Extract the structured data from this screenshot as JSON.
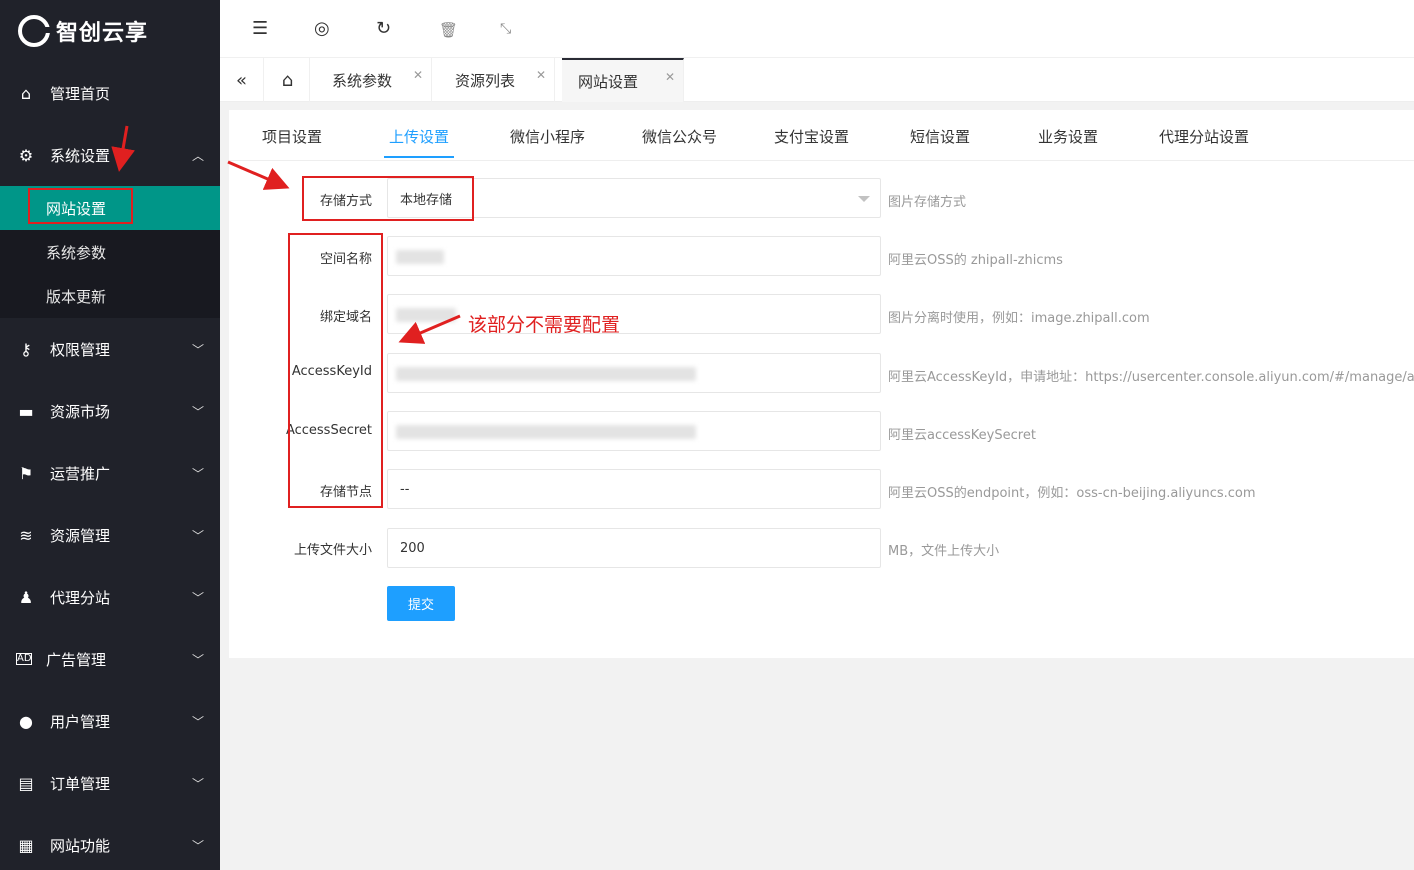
{
  "brand": {
    "name": "智创云享"
  },
  "sidebar": {
    "items": [
      {
        "label": "管理首页",
        "icon": "home-icon"
      },
      {
        "label": "系统设置",
        "icon": "gear-icon",
        "expanded": true
      },
      {
        "label": "权限管理",
        "icon": "user-key-icon"
      },
      {
        "label": "资源市场",
        "icon": "store-icon"
      },
      {
        "label": "运营推广",
        "icon": "flag-icon"
      },
      {
        "label": "资源管理",
        "icon": "layers-icon"
      },
      {
        "label": "代理分站",
        "icon": "users-icon"
      },
      {
        "label": "广告管理",
        "icon": "ad-icon"
      },
      {
        "label": "用户管理",
        "icon": "user-icon"
      },
      {
        "label": "订单管理",
        "icon": "order-icon"
      },
      {
        "label": "网站功能",
        "icon": "grid-icon"
      }
    ],
    "system_sub": [
      "网站设置",
      "系统参数",
      "版本更新"
    ]
  },
  "header": {
    "tools": [
      "menu-toggle-icon",
      "globe-icon",
      "refresh-icon",
      "trash-icon",
      "fullscreen-icon"
    ]
  },
  "page_tabs": [
    {
      "label": "系统参数"
    },
    {
      "label": "资源列表"
    },
    {
      "label": "网站设置",
      "active": true
    }
  ],
  "content_tabs": [
    "项目设置",
    "上传设置",
    "微信小程序",
    "微信公众号",
    "支付宝设置",
    "短信设置",
    "业务设置",
    "代理分站设置"
  ],
  "active_content_tab": "上传设置",
  "form": {
    "storage": {
      "label": "存储方式",
      "value": "本地存储",
      "help": "图片存储方式"
    },
    "space": {
      "label": "空间名称",
      "help": "阿里云OSS的 zhipall-zhicms"
    },
    "domain": {
      "label": "绑定域名",
      "help": "图片分离时使用，例如：image.zhipall.com"
    },
    "key_id": {
      "label": "AccessKeyId",
      "help": "阿里云AccessKeyId，申请地址：https://usercenter.console.aliyun.com/#/manage/ak"
    },
    "key_secret": {
      "label": "AccessSecret",
      "help": "阿里云accessKeySecret"
    },
    "endpoint": {
      "label": "存储节点",
      "value": "--",
      "help": "阿里云OSS的endpoint，例如：oss-cn-beijing.aliyuncs.com"
    },
    "max_size": {
      "label": "上传文件大小",
      "value": "200",
      "help": "MB，文件上传大小"
    },
    "submit_label": "提交"
  },
  "annotation": {
    "text": "该部分不需要配置",
    "color": "#e02020"
  },
  "colors": {
    "sidebar_bg": "#20222a",
    "active_sub": "#009688",
    "accent": "#1e9fff"
  }
}
